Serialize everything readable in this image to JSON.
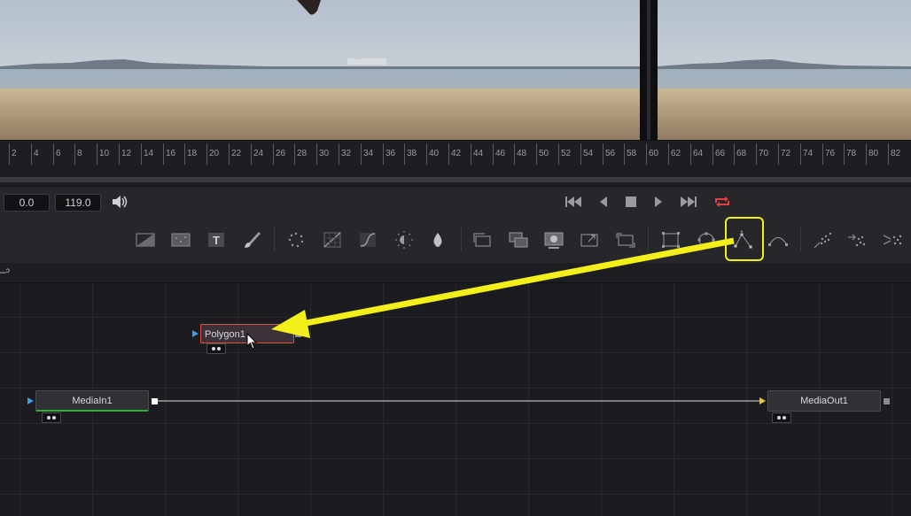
{
  "ruler": {
    "labels": [
      "2",
      "4",
      "6",
      "8",
      "10",
      "12",
      "14",
      "16",
      "18",
      "20",
      "22",
      "24",
      "26",
      "28",
      "30",
      "32",
      "34",
      "36",
      "38",
      "40",
      "42",
      "44",
      "46",
      "48",
      "50",
      "52",
      "54",
      "56",
      "58",
      "60",
      "62",
      "64",
      "66",
      "68",
      "70",
      "72",
      "74",
      "76",
      "78",
      "80",
      "82"
    ]
  },
  "transport": {
    "start_time": "0.0",
    "end_time": "119.0"
  },
  "tabs": {
    "active_label": "–ᵓ"
  },
  "nodes": {
    "polygon": {
      "name": "Polygon1"
    },
    "media_in": {
      "name": "MediaIn1"
    },
    "media_out": {
      "name": "MediaOut1"
    }
  },
  "colors": {
    "highlight": "#f2ef1a",
    "loop_active": "#e0433a",
    "media_in_output": "#2fae3a",
    "selected_node_border": "#d8553a",
    "input_port_blue": "#3a9fe0",
    "output_port_yellow": "#e8c832"
  },
  "icons": [
    "volume-icon",
    "go-to-start-icon",
    "play-reverse-icon",
    "stop-icon",
    "play-icon",
    "go-to-end-icon",
    "loop-icon",
    "background-tool-icon",
    "fast-noise-tool-icon",
    "text-tool-icon",
    "paint-tool-icon",
    "particles-tool-icon",
    "color-curves-tool-icon",
    "brightness-contrast-tool-icon",
    "color-corrector-tool-icon",
    "blur-tool-icon",
    "merge-tool-icon",
    "transform-tool-icon",
    "dve-tool-icon",
    "resize-tool-icon",
    "rectangle-mask-icon",
    "ellipse-mask-icon",
    "polygon-mask-icon",
    "bspline-mask-icon",
    "pemitter-icon",
    "prender-icon",
    "pmerge-icon"
  ]
}
